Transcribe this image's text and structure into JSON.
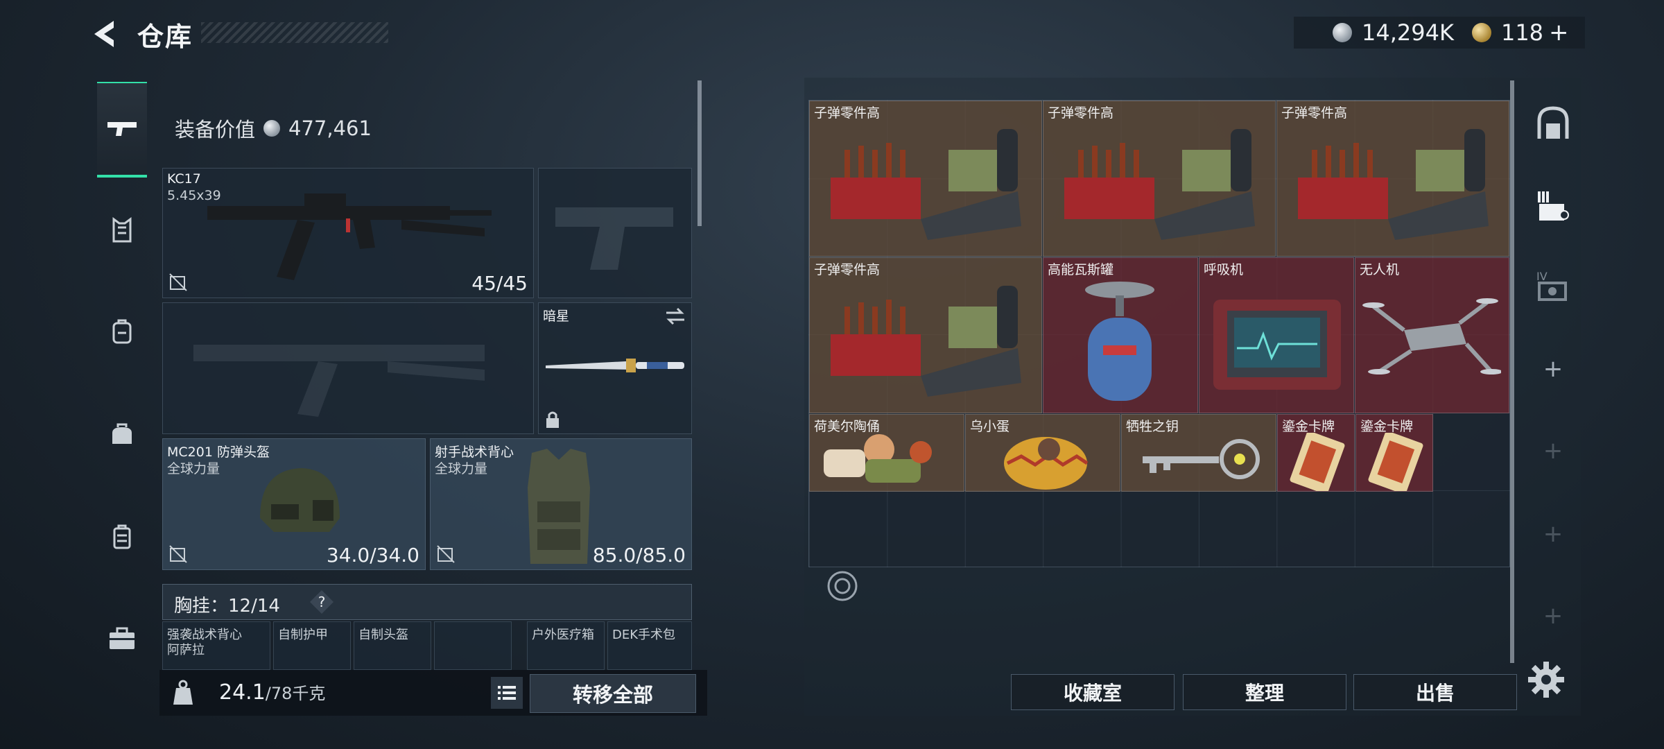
{
  "header": {
    "title": "仓库",
    "currency": {
      "silver": "14,294K",
      "gold": "118",
      "plus": "+"
    }
  },
  "left_nav": [
    "weapon-icon",
    "armor-icon",
    "backpack-icon",
    "bag-icon",
    "case-icon",
    "toolbox-icon"
  ],
  "equipment": {
    "value_label": "装备价值",
    "value": "477,461",
    "primary_weapon": {
      "name": "KC17",
      "caliber": "5.45x39",
      "durability": "45/45"
    },
    "melee": {
      "name": "暗星"
    },
    "helmet": {
      "name": "MC201 防弹头盔",
      "faction": "全球力量",
      "durability": "34.0/34.0"
    },
    "vest": {
      "name": "射手战术背心",
      "faction": "全球力量",
      "durability": "85.0/85.0"
    },
    "chest_rig": {
      "label": "胸挂：",
      "count": "12/14",
      "help": "?"
    },
    "sub_slots": [
      "强袭战术背心",
      "阿萨拉",
      "自制护甲",
      "自制头盔",
      "户外医疗箱",
      "DEK手术包"
    ],
    "weight": {
      "current": "24.1",
      "max": "/78千克"
    },
    "transfer_all": "转移全部"
  },
  "storage": {
    "items": [
      {
        "label": "子弹零件高",
        "color": "brown",
        "type": "ammo-kit"
      },
      {
        "label": "子弹零件高",
        "color": "brown",
        "type": "ammo-kit"
      },
      {
        "label": "子弹零件高",
        "color": "brown",
        "type": "ammo-kit"
      },
      {
        "label": "子弹零件高",
        "color": "brown",
        "type": "ammo-kit"
      },
      {
        "label": "高能瓦斯罐",
        "color": "red",
        "type": "gas-tank"
      },
      {
        "label": "呼吸机",
        "color": "red",
        "type": "ventilator"
      },
      {
        "label": "无人机",
        "color": "red",
        "type": "drone"
      },
      {
        "label": "荷美尔陶俑",
        "color": "brown",
        "type": "figurine"
      },
      {
        "label": "乌小蛋",
        "color": "brown",
        "type": "egg"
      },
      {
        "label": "牺牲之钥",
        "color": "brown",
        "type": "key"
      },
      {
        "label": "鎏金卡牌",
        "color": "red",
        "type": "card"
      },
      {
        "label": "鎏金卡牌",
        "color": "red",
        "type": "card"
      }
    ],
    "buttons": {
      "collection": "收藏室",
      "sort": "整理",
      "sell": "出售"
    }
  },
  "right_rail": [
    "storage-icon",
    "tier-3-gear-icon",
    "tier-4-gear-icon",
    "+",
    "+",
    "+",
    "+"
  ],
  "colors": {
    "accent": "#33e0a8",
    "brown_item": "#64503a",
    "red_item": "#6e2832"
  }
}
